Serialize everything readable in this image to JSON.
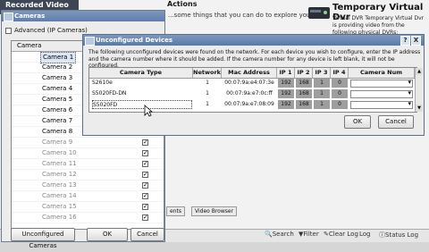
{
  "background": {
    "left_header": "Recorded Video",
    "actions_title": "Actions",
    "actions_desc": "...some things that you can do to explore your",
    "right_title": "Temporary Virtual Dvr",
    "right_desc": "Virtual DVR Temporary Virtual Dvr is providing video from the following physical DVRs:",
    "tabs": [
      "ents",
      "Video Browser"
    ],
    "status_items": [
      "Search",
      "Filter",
      "Clear Log",
      "Log",
      "Status Log"
    ]
  },
  "cameras_dialog": {
    "title": "Cameras",
    "advanced_label": "Advanced (IP Cameras)",
    "column_camera": "Camera",
    "rows": [
      {
        "name": "Camera 1",
        "checked": true,
        "enabled": true,
        "selected": true
      },
      {
        "name": "Camera 2",
        "checked": true,
        "enabled": true
      },
      {
        "name": "Camera 3",
        "checked": true,
        "enabled": true
      },
      {
        "name": "Camera 4",
        "checked": true,
        "enabled": true
      },
      {
        "name": "Camera 5",
        "checked": true,
        "enabled": true
      },
      {
        "name": "Camera 6",
        "checked": true,
        "enabled": true
      },
      {
        "name": "Camera 7",
        "checked": true,
        "enabled": true
      },
      {
        "name": "Camera 8",
        "checked": true,
        "enabled": true
      },
      {
        "name": "Camera 9",
        "checked": true,
        "enabled": false
      },
      {
        "name": "Camera 10",
        "checked": true,
        "enabled": false
      },
      {
        "name": "Camera 11",
        "checked": true,
        "enabled": false
      },
      {
        "name": "Camera 12",
        "checked": true,
        "enabled": false
      },
      {
        "name": "Camera 13",
        "checked": true,
        "enabled": false
      },
      {
        "name": "Camera 14",
        "checked": true,
        "enabled": false
      },
      {
        "name": "Camera 15",
        "checked": true,
        "enabled": false
      },
      {
        "name": "Camera 16",
        "checked": true,
        "enabled": false
      }
    ],
    "buttons": {
      "unconfigured": "Unconfigured Cameras",
      "ok": "OK",
      "cancel": "Cancel"
    }
  },
  "unconfigured_dialog": {
    "title": "Unconfigured Devices",
    "help_button": "?",
    "close_button": "X",
    "description": "The following unconfigured devices were found on the network.  For each device you wish to configure, enter the IP address and the camera number where it should be added.  If the camera number for any device is left blank, it will not be configured.",
    "columns": [
      "Camera Type",
      "Network",
      "Mac Address",
      "IP 1",
      "IP 2",
      "IP 3",
      "IP 4",
      "Camera Num"
    ],
    "rows": [
      {
        "type": "S2610e",
        "network": "1",
        "mac": "00:07:9a:e4:07:3e",
        "ip1": "192",
        "ip2": "168",
        "ip3": "1",
        "ip4": "0"
      },
      {
        "type": "S5020FD-DN",
        "network": "1",
        "mac": "00:07:9a:e7:0c:ff",
        "ip1": "192",
        "ip2": "168",
        "ip3": "1",
        "ip4": "0"
      },
      {
        "type": "S5020FD",
        "network": "1",
        "mac": "00:07:9a:e7:08:09",
        "ip1": "192",
        "ip2": "168",
        "ip3": "1",
        "ip4": "0"
      }
    ],
    "buttons": {
      "ok": "OK",
      "cancel": "Cancel"
    }
  }
}
